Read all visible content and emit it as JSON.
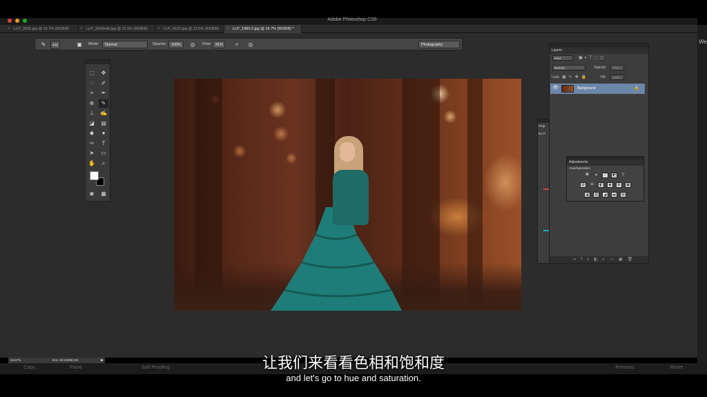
{
  "window": {
    "title": "Adobe Photoshop CS6"
  },
  "tabs": [
    {
      "label": "LLP_3935.jpg @ 16.7% (RGB/8)",
      "active": false
    },
    {
      "label": "LLP_3943edit.jpg @ 12.5% (RGB/8)",
      "active": false
    },
    {
      "label": "LLP_4123.jpg @ 12.5% (RGB/8)",
      "active": false
    },
    {
      "label": "LLP_1983-2.jpg @ 16.7% (RGB/8) *",
      "active": true
    }
  ],
  "options_bar": {
    "brush_size": "400",
    "mode_label": "Mode:",
    "mode_value": "Normal",
    "opacity_label": "Opacity:",
    "opacity_value": "100%",
    "flow_label": "Flow:",
    "flow_value": "41%",
    "workspace": "Photography"
  },
  "layers_panel": {
    "title": "Layers",
    "filter": "Kind",
    "blend": "Normal",
    "opacity_label": "Opacity:",
    "opacity_value": "100%",
    "lock_label": "Lock:",
    "fill_label": "Fill:",
    "fill_value": "100%",
    "layer_name": "Background"
  },
  "properties_panel": {
    "title": "Prop",
    "sub": "No P"
  },
  "adjustments_panel": {
    "title": "Adjustments",
    "hint": "Hue/Saturation"
  },
  "status_bar": {
    "zoom": "16.67%",
    "doc": "Doc: 59.1M/59.1M"
  },
  "bottom_bar": {
    "copy": "Copy...",
    "paste": "Paste",
    "soft_proofing": "Soft Proofing",
    "previous": "Previous",
    "reset": "Reset"
  },
  "right_strip": {
    "label": "Web"
  },
  "subtitles": {
    "zh": "让我们来看看色相和饱和度",
    "en": "and let's go to hue and saturation."
  }
}
